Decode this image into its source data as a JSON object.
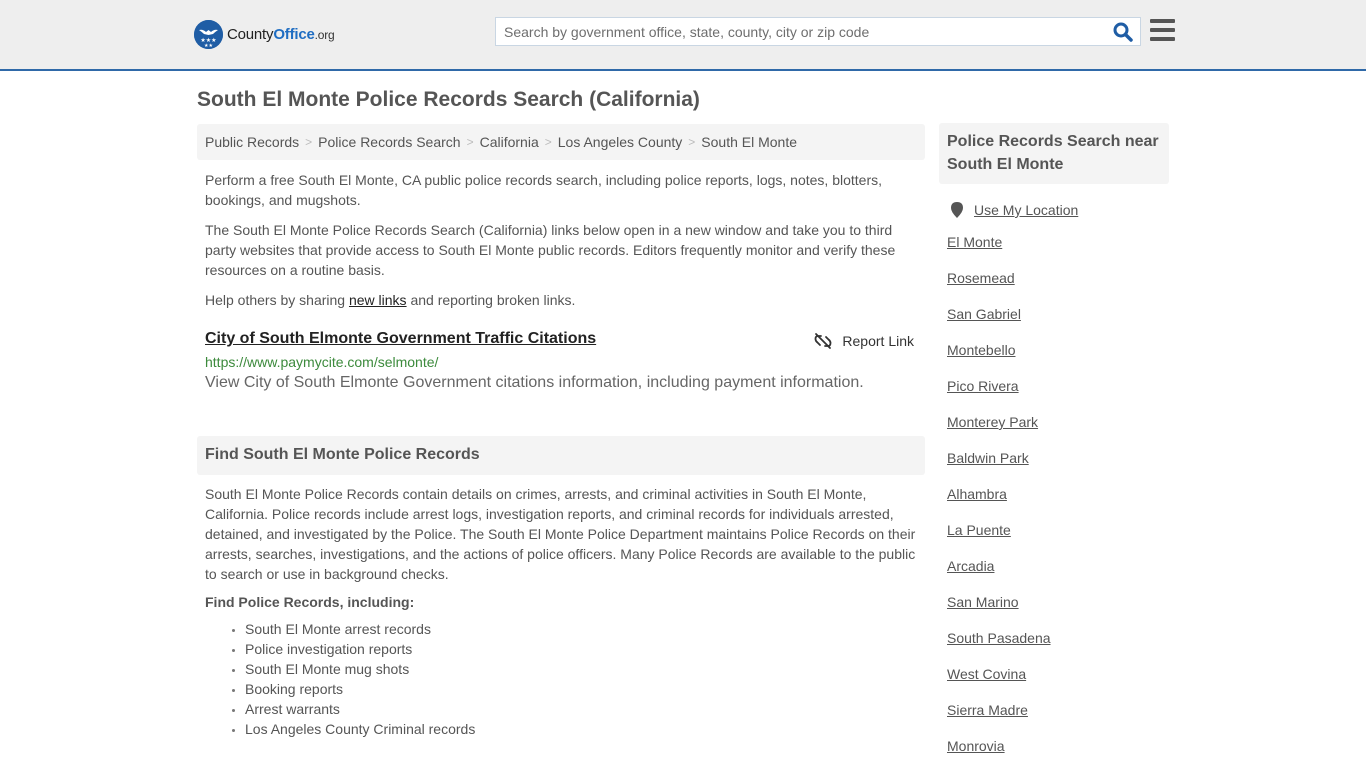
{
  "header": {
    "logo": {
      "county": "County",
      "office": "Office",
      "org": ".org"
    },
    "search": {
      "placeholder": "Search by government office, state, county, city or zip code",
      "value": ""
    },
    "search_icon": "search-icon",
    "menu_icon": "hamburger-menu-icon"
  },
  "page": {
    "title": "South El Monte Police Records Search (California)"
  },
  "breadcrumb": [
    {
      "label": "Public Records"
    },
    {
      "label": "Police Records Search"
    },
    {
      "label": "California"
    },
    {
      "label": "Los Angeles County"
    },
    {
      "label": "South El Monte"
    }
  ],
  "breadcrumb_separator": ">",
  "intro": {
    "p1": "Perform a free South El Monte, CA public police records search, including police reports, logs, notes, blotters, bookings, and mugshots.",
    "p2": "The South El Monte Police Records Search (California) links below open in a new window and take you to third party websites that provide access to South El Monte public records. Editors frequently monitor and verify these resources on a routine basis.",
    "p3_before": "Help others by sharing ",
    "p3_link": "new links",
    "p3_after": " and reporting broken links."
  },
  "results": [
    {
      "title": "City of South Elmonte Government Traffic Citations",
      "url": "https://www.paymycite.com/selmonte/",
      "description": "View City of South Elmonte Government citations information, including payment information.",
      "report_label": "Report Link"
    }
  ],
  "find_section": {
    "heading": "Find South El Monte Police Records",
    "paragraph": "South El Monte Police Records contain details on crimes, arrests, and criminal activities in South El Monte, California. Police records include arrest logs, investigation reports, and criminal records for individuals arrested, detained, and investigated by the Police. The South El Monte Police Department maintains Police Records on their arrests, searches, investigations, and the actions of police officers. Many Police Records are available to the public to search or use in background checks.",
    "subheading": "Find Police Records, including:",
    "items": [
      "South El Monte arrest records",
      "Police investigation reports",
      "South El Monte mug shots",
      "Booking reports",
      "Arrest warrants",
      "Los Angeles County Criminal records"
    ]
  },
  "sidebar": {
    "heading": "Police Records Search near South El Monte",
    "use_location": "Use My Location",
    "nearby": [
      "El Monte",
      "Rosemead",
      "San Gabriel",
      "Montebello",
      "Pico Rivera",
      "Monterey Park",
      "Baldwin Park",
      "Alhambra",
      "La Puente",
      "Arcadia",
      "San Marino",
      "South Pasadena",
      "West Covina",
      "Sierra Madre",
      "Monrovia"
    ]
  },
  "colors": {
    "header_bg": "#eeeeee",
    "header_border": "#2f69a8",
    "brand_blue": "#1f6dc2",
    "url_green": "#3c8a3c",
    "panel_bg": "#f4f4f4",
    "text": "#555555"
  }
}
